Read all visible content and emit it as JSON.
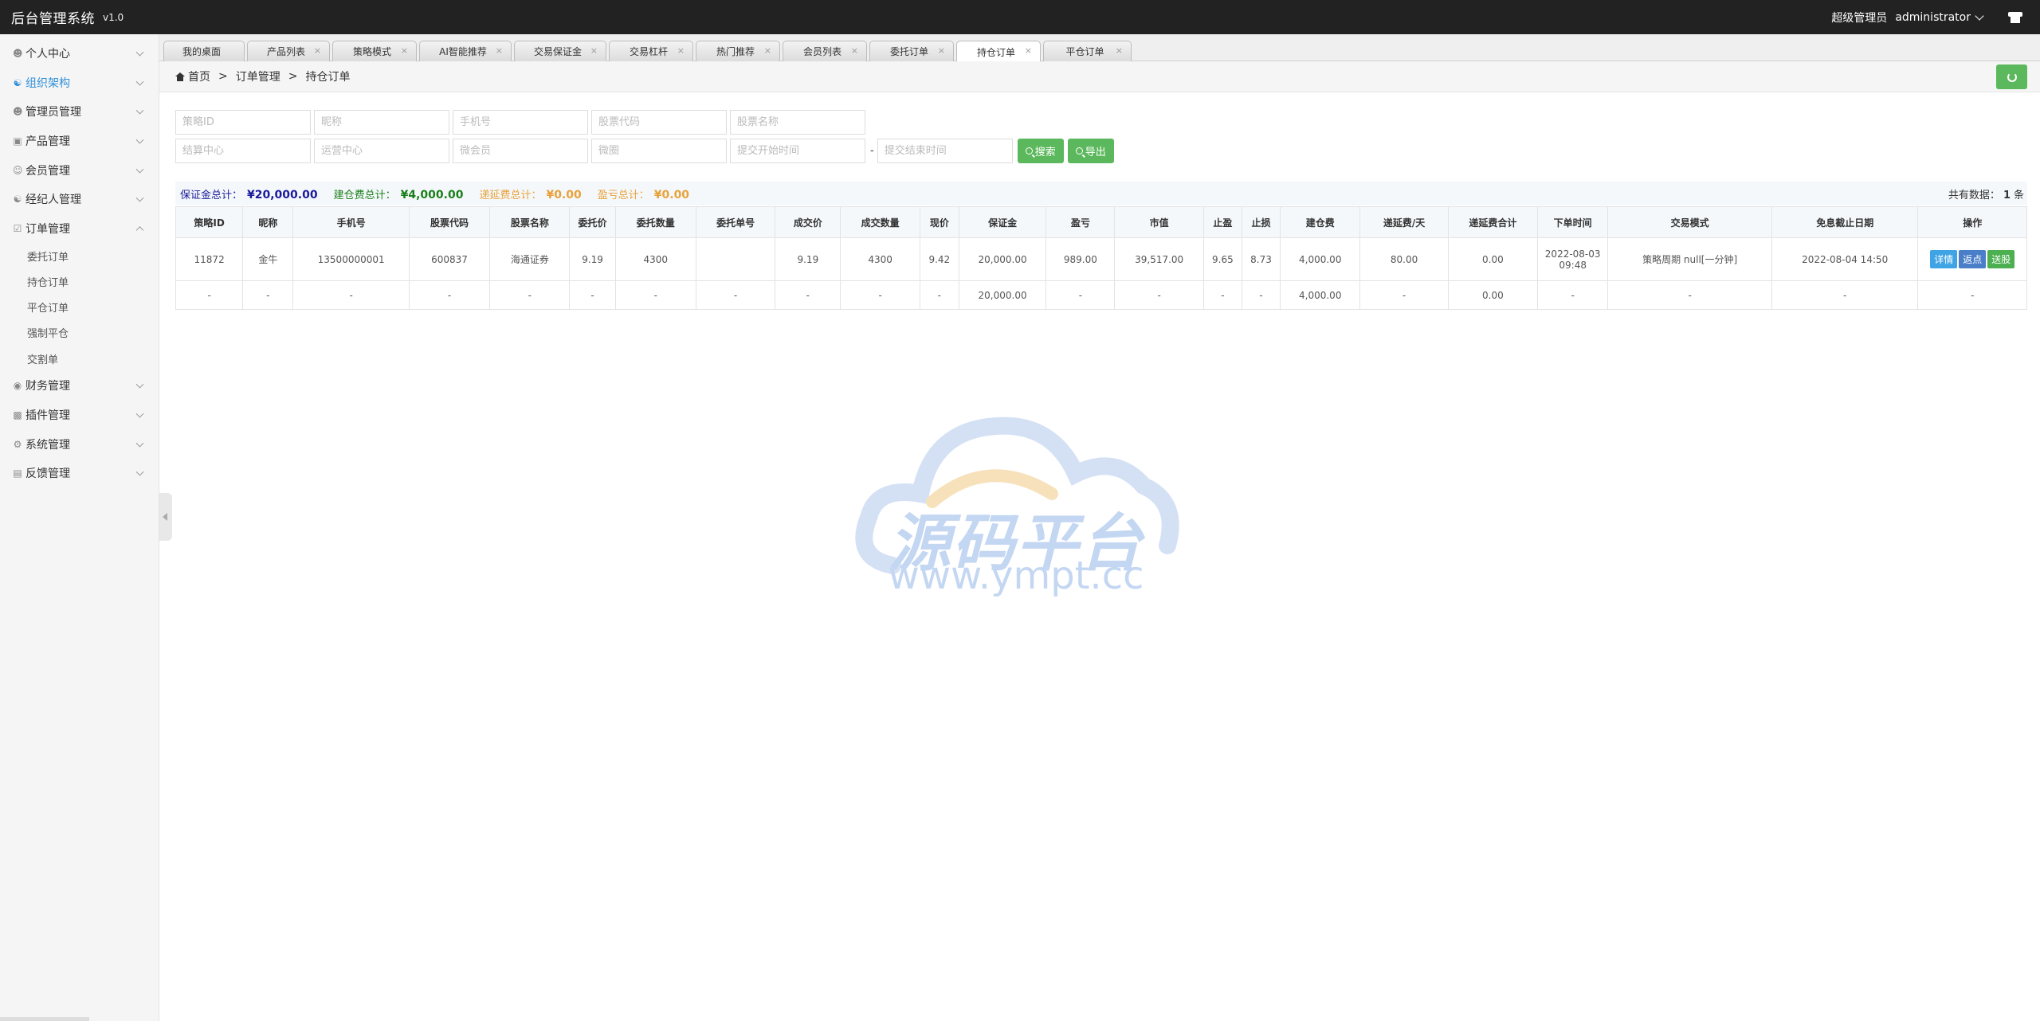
{
  "app": {
    "title": "后台管理系统",
    "version": "v1.0"
  },
  "header": {
    "role": "超级管理员",
    "user": "administrator"
  },
  "sidebar": {
    "items": [
      {
        "label": "个人中心"
      },
      {
        "label": "组织架构"
      },
      {
        "label": "管理员管理"
      },
      {
        "label": "产品管理"
      },
      {
        "label": "会员管理"
      },
      {
        "label": "经纪人管理"
      },
      {
        "label": "订单管理"
      },
      {
        "label": "财务管理"
      },
      {
        "label": "插件管理"
      },
      {
        "label": "系统管理"
      },
      {
        "label": "反馈管理"
      }
    ],
    "sub_items": [
      {
        "label": "委托订单"
      },
      {
        "label": "持仓订单"
      },
      {
        "label": "平仓订单"
      },
      {
        "label": "强制平仓"
      },
      {
        "label": "交割单"
      }
    ]
  },
  "tabs": [
    {
      "label": "我的桌面"
    },
    {
      "label": "产品列表"
    },
    {
      "label": "策略模式"
    },
    {
      "label": "AI智能推荐"
    },
    {
      "label": "交易保证金"
    },
    {
      "label": "交易杠杆"
    },
    {
      "label": "热门推荐"
    },
    {
      "label": "会员列表"
    },
    {
      "label": "委托订单"
    },
    {
      "label": "持仓订单"
    },
    {
      "label": "平仓订单"
    }
  ],
  "tab_close": "×",
  "breadcrumb": {
    "home": "首页",
    "sep": ">",
    "level1": "订单管理",
    "level2": "持仓订单"
  },
  "filters": {
    "strategy_id": "策略ID",
    "nickname": "昵称",
    "phone": "手机号",
    "stock_code": "股票代码",
    "stock_name": "股票名称",
    "settle_center": "结算中心",
    "ops_center": "运营中心",
    "micro_member": "微会员",
    "micro_circle": "微圈",
    "start_time": "提交开始时间",
    "end_time": "提交结束时间",
    "dash": "-",
    "search_label": "搜索",
    "export_label": "导出"
  },
  "summary": {
    "margin_label": "保证金总计：",
    "margin_value": "¥20,000.00",
    "open_fee_label": "建仓费总计：",
    "open_fee_value": "¥4,000.00",
    "defer_fee_label": "递延费总计：",
    "defer_fee_value": "¥0.00",
    "pnl_label": "盈亏总计：",
    "pnl_value": "¥0.00",
    "total_prefix": "共有数据：",
    "total_count": "1",
    "total_suffix": "条"
  },
  "table": {
    "headers": [
      "策略ID",
      "昵称",
      "手机号",
      "股票代码",
      "股票名称",
      "委托价",
      "委托数量",
      "委托单号",
      "成交价",
      "成交数量",
      "现价",
      "保证金",
      "盈亏",
      "市值",
      "止盈",
      "止损",
      "建仓费",
      "递延费/天",
      "递延费合计",
      "下单时间",
      "交易模式",
      "免息截止日期",
      "操作"
    ],
    "row": {
      "id": "11872",
      "nickname": "金牛",
      "phone": "13500000001",
      "code": "600837",
      "name": "海通证券",
      "order_price": "9.19",
      "order_qty": "4300",
      "order_no": "",
      "deal_price": "9.19",
      "deal_qty": "4300",
      "cur_price": "9.42",
      "margin": "20,000.00",
      "pnl": "989.00",
      "market_value": "39,517.00",
      "take_profit": "9.65",
      "stop_loss": "8.73",
      "open_fee": "4,000.00",
      "defer_daily": "80.00",
      "defer_total": "0.00",
      "order_date": "2022-08-03",
      "order_clock": "09:48",
      "mode": "策略周期 null[一分钟]",
      "free_until": "2022-08-04 14:50"
    },
    "actions": {
      "detail": "详情",
      "rebate": "返点",
      "deliver": "送股"
    },
    "total_row": {
      "dash": "-",
      "margin": "20,000.00",
      "open_fee": "4,000.00",
      "defer_total": "0.00"
    }
  },
  "watermark": {
    "text": "源码平台",
    "url": "www.ympt.cc"
  },
  "colors": {
    "topbar": "#222222",
    "accent_green": "#5cb85c",
    "profit_red": "#c9302c",
    "active_menu": "#2f8fd8"
  }
}
